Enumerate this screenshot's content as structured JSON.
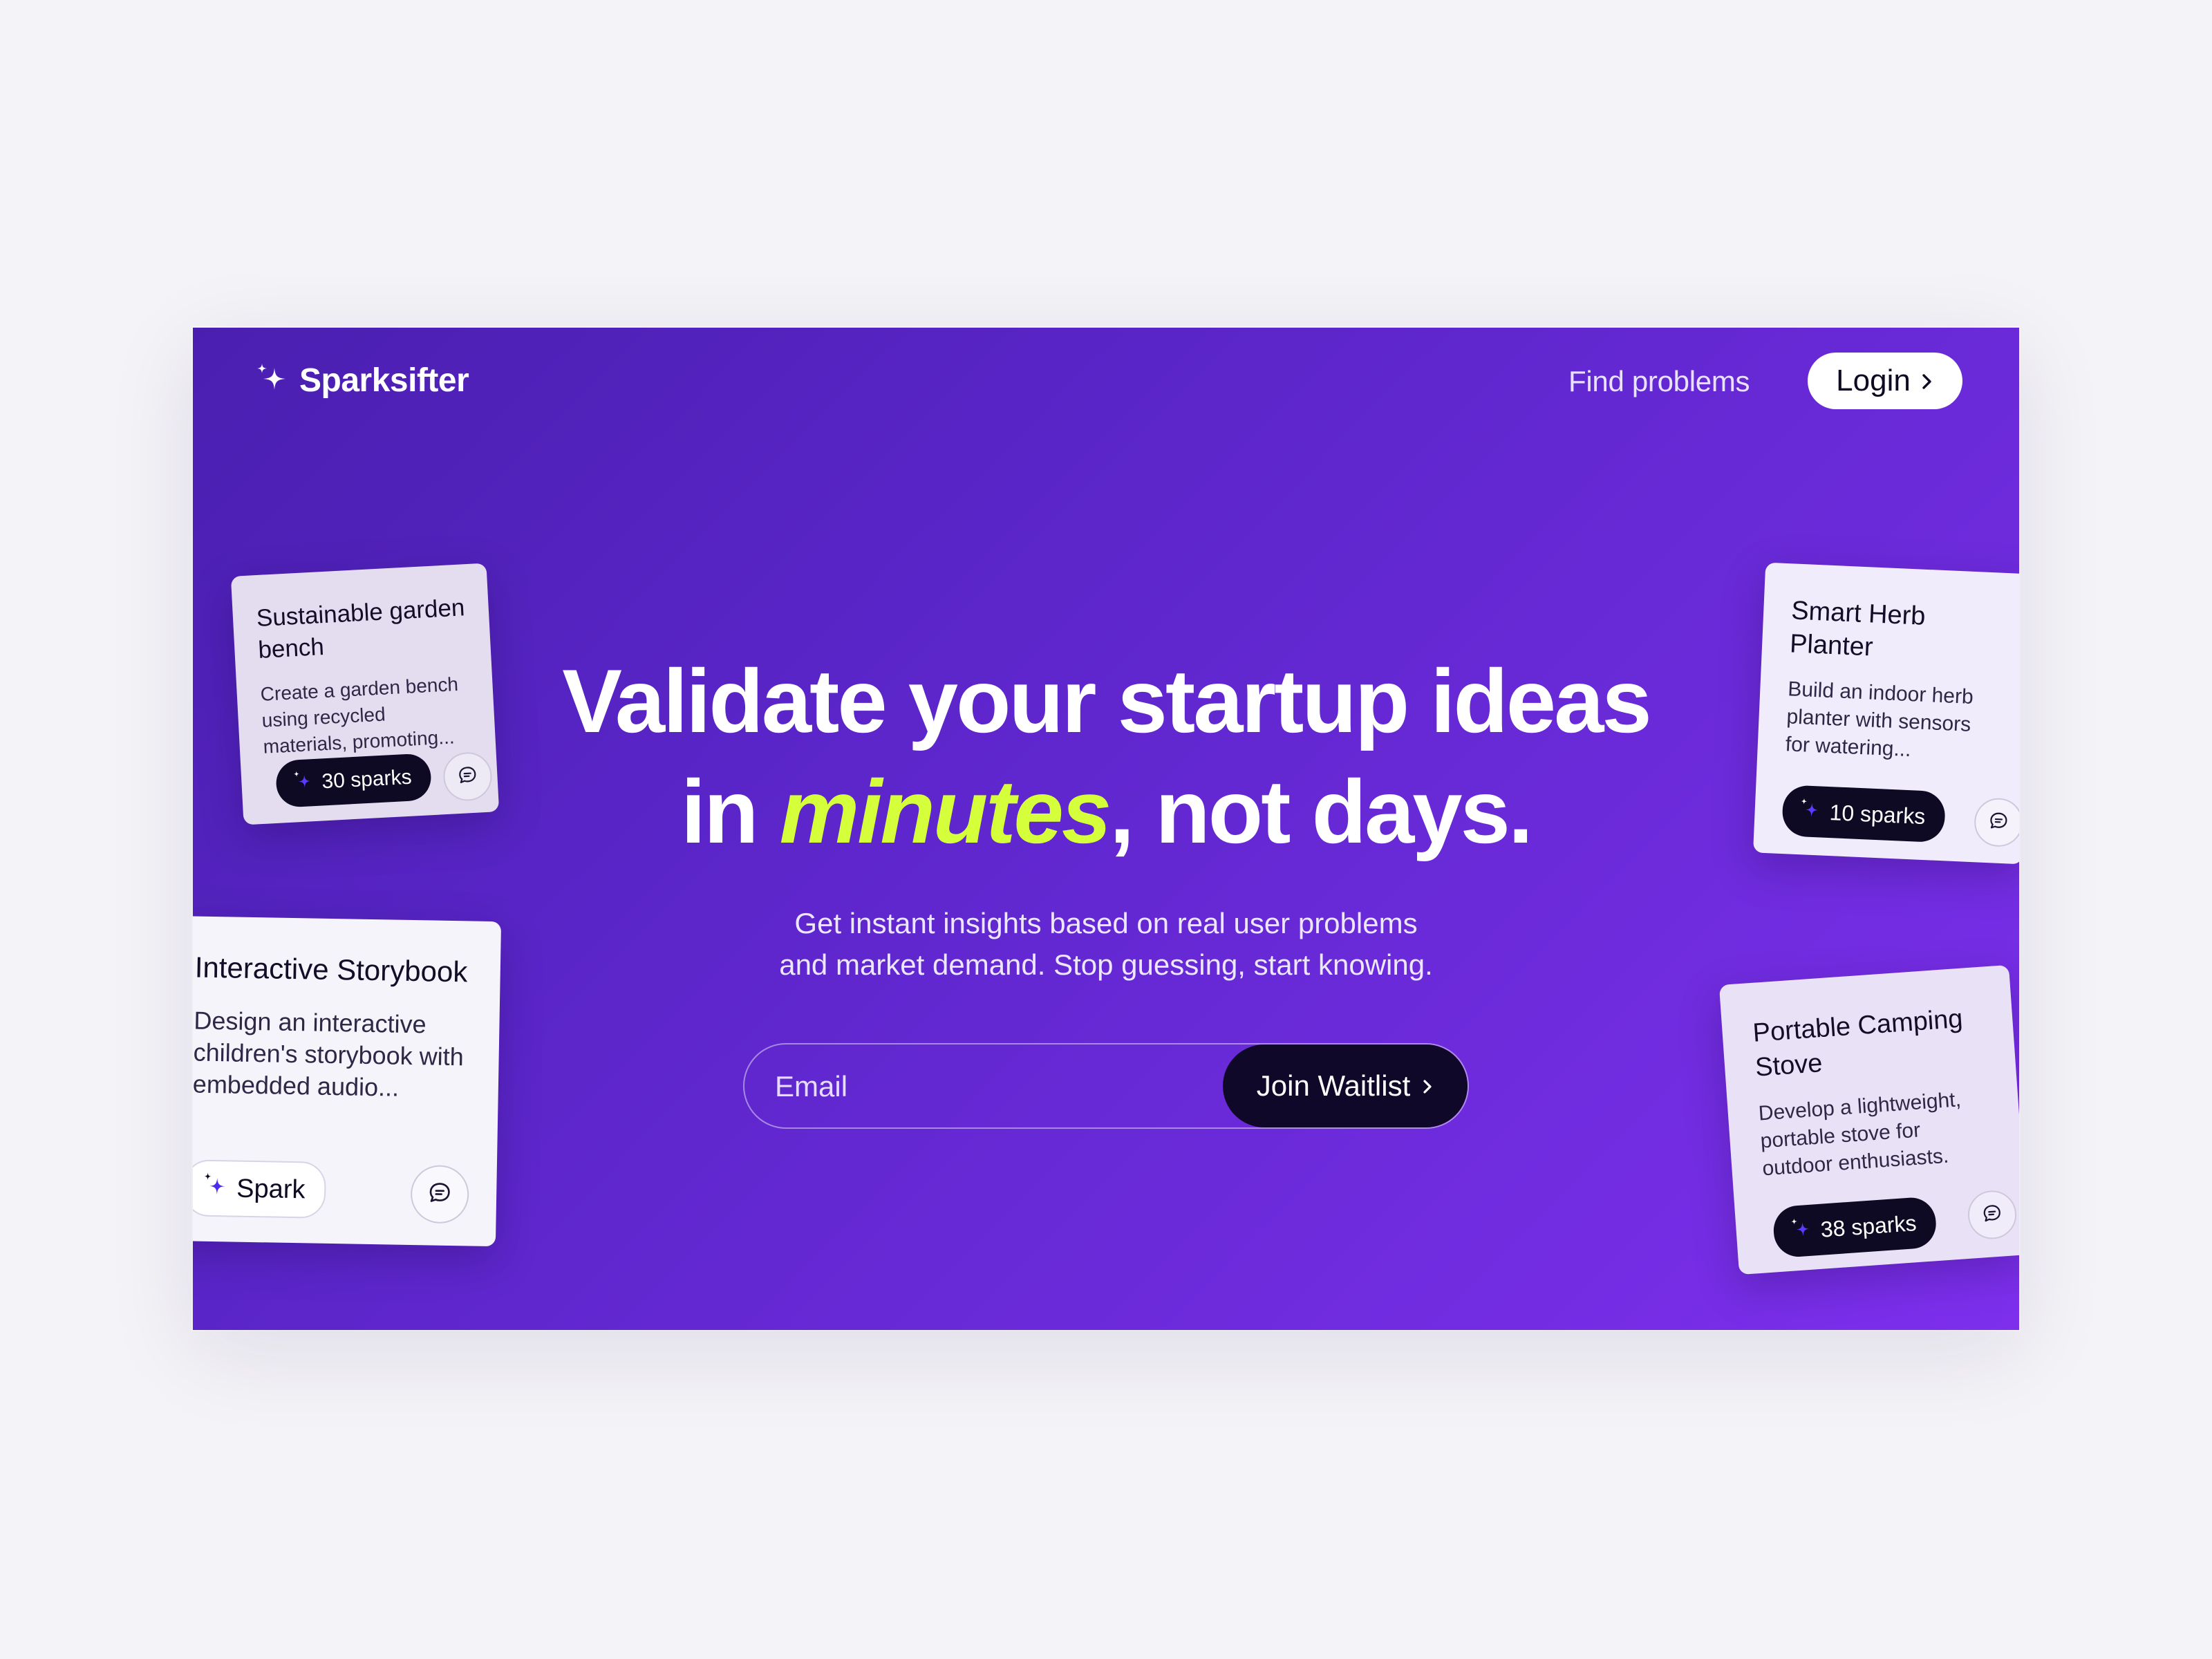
{
  "brand": {
    "name": "Sparksifter",
    "icon": "sparkle-icon",
    "accent_color": "#d4ff3a",
    "background_gradient": [
      "#4a1fb0",
      "#7d2fec"
    ]
  },
  "nav": {
    "find_problems": "Find problems",
    "login_label": "Login",
    "login_icon": "chevron-right-icon"
  },
  "hero": {
    "headline_line1": "Validate your startup ideas",
    "headline_line2_pre": "in ",
    "headline_accent": "minutes",
    "headline_line2_post": ", not days.",
    "subtext_line1": "Get instant insights based on real user problems",
    "subtext_line2": "and market demand. Stop guessing, start knowing."
  },
  "waitlist": {
    "email_placeholder": "Email",
    "email_value": "",
    "button_label": "Join Waitlist",
    "button_icon": "chevron-right-icon"
  },
  "cards": [
    {
      "title": "Sustainable garden bench",
      "description": "Create a garden bench using recycled materials, promoting...",
      "sparks": "30 sparks",
      "comment_icon": "comment-icon"
    },
    {
      "title": "Interactive Storybook",
      "description": "Design an interactive children's storybook with embedded audio...",
      "sparks": "Spark",
      "comment_icon": "comment-icon"
    },
    {
      "title": "Smart Herb Planter",
      "description": "Build an indoor herb planter with sensors for watering...",
      "sparks": "10 sparks",
      "comment_icon": "comment-icon"
    },
    {
      "title": "Portable Camping Stove",
      "description": "Develop a lightweight, portable stove for outdoor enthusiasts.",
      "sparks": "38 sparks",
      "comment_icon": "comment-icon"
    }
  ]
}
